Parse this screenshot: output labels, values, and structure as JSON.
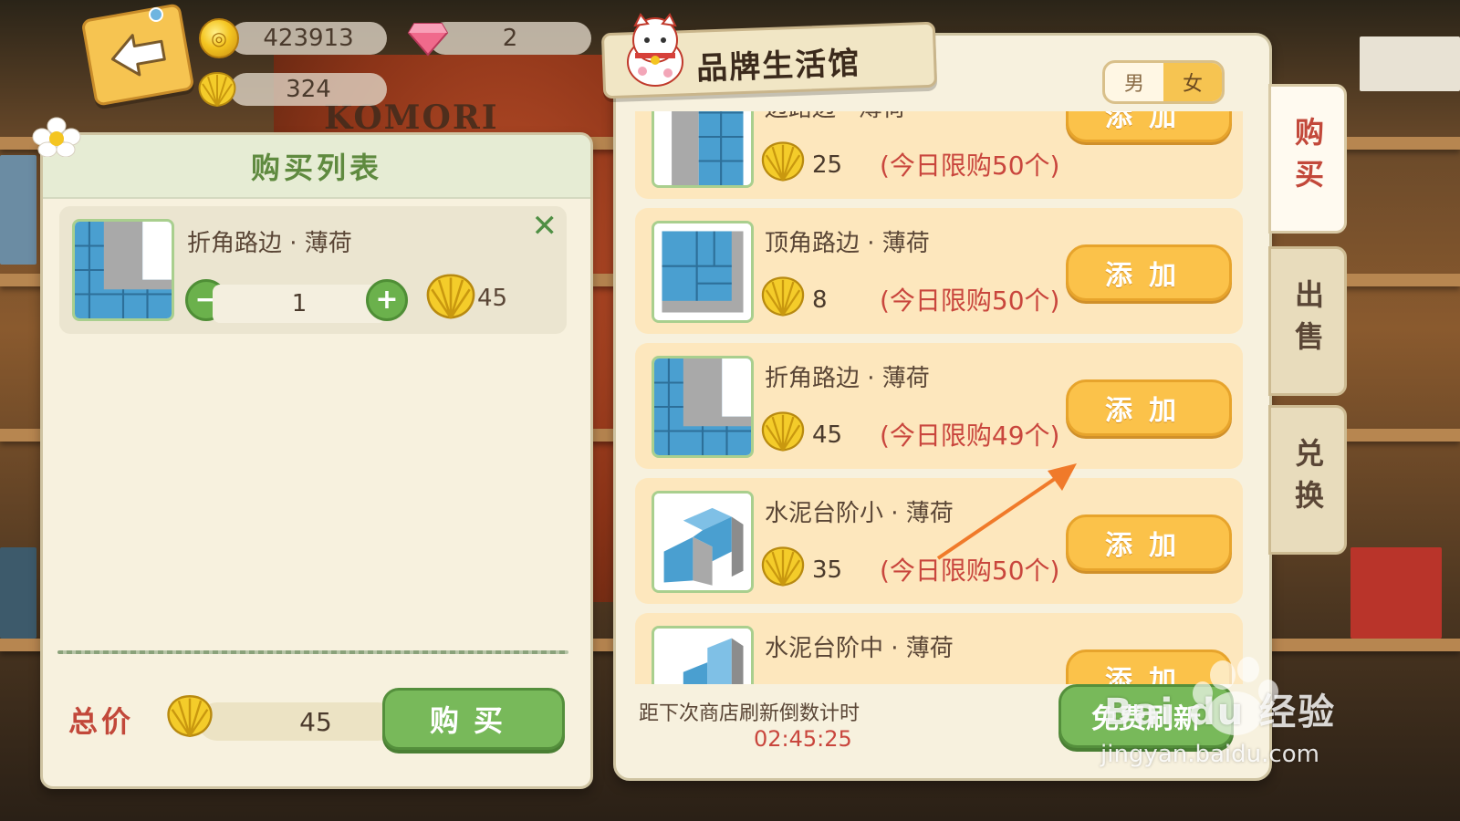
{
  "currency": {
    "coins": "423913",
    "gems": "2",
    "shells": "324"
  },
  "background": {
    "logo_text": "KOMORI"
  },
  "cart": {
    "title": "购买列表",
    "item": {
      "name": "折角路边 · 薄荷",
      "quantity": "1",
      "price": "45"
    },
    "total_label": "总价",
    "total_value": "45",
    "buy_label": "购买"
  },
  "shop": {
    "title": "品牌生活馆",
    "gender_tabs": [
      {
        "label": "男",
        "active": false
      },
      {
        "label": "女",
        "active": true
      }
    ],
    "items": [
      {
        "name": "边路边 · 薄荷",
        "price": "25",
        "limit": "(今日限购50个)",
        "add_label": "添加",
        "shape": "edge"
      },
      {
        "name": "顶角路边 · 薄荷",
        "price": "8",
        "limit": "(今日限购50个)",
        "add_label": "添加",
        "shape": "corner"
      },
      {
        "name": "折角路边 · 薄荷",
        "price": "45",
        "limit": "(今日限购49个)",
        "add_label": "添加",
        "shape": "l"
      },
      {
        "name": "水泥台阶小 · 薄荷",
        "price": "35",
        "limit": "(今日限购50个)",
        "add_label": "添加",
        "shape": "stair-small"
      },
      {
        "name": "水泥台阶中 · 薄荷",
        "price": "",
        "limit": "",
        "add_label": "添加",
        "shape": "stair-mid"
      }
    ],
    "refresh_label": "距下次商店刷新倒数计时",
    "refresh_countdown": "02:45:25",
    "free_refresh_label": "免费刷新",
    "side_tabs": [
      {
        "label": "购买",
        "active": true
      },
      {
        "label": "出售",
        "active": false
      },
      {
        "label": "兑换",
        "active": false
      }
    ]
  },
  "watermark": {
    "text": "Bai du 经验",
    "url": "jingyan.baidu.com"
  },
  "colors": {
    "accent_green": "#78b95a",
    "add_yellow": "#fbc24a",
    "limit_red": "#c9463d",
    "panel_bg": "#f7f1de"
  }
}
